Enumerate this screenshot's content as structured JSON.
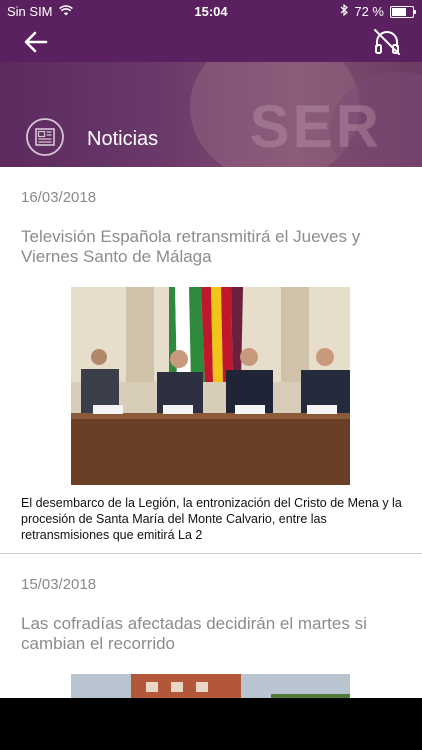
{
  "status": {
    "carrier": "Sin SIM",
    "time": "15:04",
    "battery_text": "72 %",
    "battery_level": 0.72
  },
  "nav": {
    "back_icon": "arrow-left-icon",
    "mute_icon": "headphones-off-icon"
  },
  "section": {
    "title": "Noticias",
    "icon": "newspaper-icon"
  },
  "articles": [
    {
      "date": "16/03/2018",
      "title": "Televisión Española retransmitirá el Jueves y Viernes Santo de Málaga",
      "caption": "El desembarco de la Legión, la entronización del Cristo de Mena y la procesión de Santa María del Monte Calvario, entre las retransmisiones que emitirá La 2"
    },
    {
      "date": "15/03/2018",
      "title": "Las cofradías afectadas decidirán el martes si cambian el recorrido"
    }
  ],
  "colors": {
    "brand": "#5b2060",
    "text_muted": "#8a8a8a"
  }
}
